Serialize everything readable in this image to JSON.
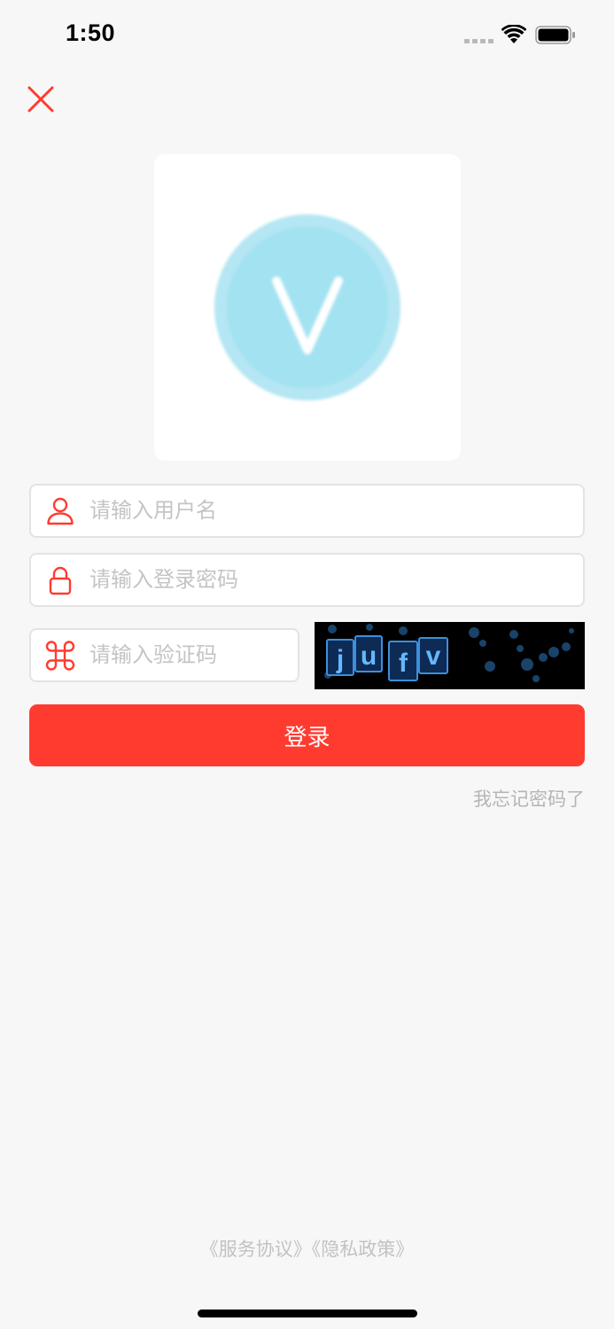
{
  "status_bar": {
    "time": "1:50"
  },
  "logo": {
    "letter": "V",
    "circle_color": "#a3e2f1"
  },
  "form": {
    "username_placeholder": "请输入用户名",
    "password_placeholder": "请输入登录密码",
    "captcha_placeholder": "请输入验证码",
    "captcha_text": "jufv",
    "login_label": "登录",
    "forgot_label": "我忘记密码了"
  },
  "footer": {
    "service_agreement": "《服务协议》",
    "privacy_policy": "《隐私政策》"
  },
  "colors": {
    "accent": "#ff3b30",
    "background": "#f7f7f7",
    "placeholder": "#c4c4c4",
    "muted_text": "#b5b5b5"
  },
  "icons": {
    "close": "close-icon",
    "user": "user-icon",
    "lock": "lock-icon",
    "captcha": "command-icon"
  }
}
